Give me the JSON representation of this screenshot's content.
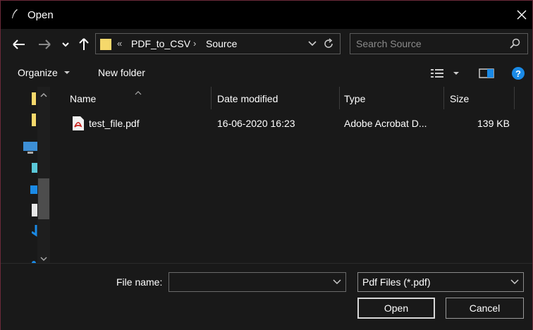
{
  "window": {
    "title": "Open"
  },
  "address": {
    "overflow": "«",
    "crumbs": [
      "PDF_to_CSV",
      "Source"
    ]
  },
  "search": {
    "placeholder": "Search Source"
  },
  "toolbar": {
    "organize_label": "Organize",
    "new_folder_label": "New folder"
  },
  "columns": {
    "name": "Name",
    "date": "Date modified",
    "type": "Type",
    "size": "Size"
  },
  "files": [
    {
      "name": "test_file.pdf",
      "date": "16-06-2020 16:23",
      "type": "Adobe Acrobat D...",
      "size": "139 KB"
    }
  ],
  "bottom": {
    "file_name_label": "File name:",
    "file_name_value": "",
    "filter_value": "Pdf Files (*.pdf)",
    "open_label": "Open",
    "cancel_label": "Cancel"
  },
  "colors": {
    "accent_blue": "#1a8ae6",
    "pdf_red": "#c8201b",
    "folder_yellow": "#f5d86b"
  }
}
